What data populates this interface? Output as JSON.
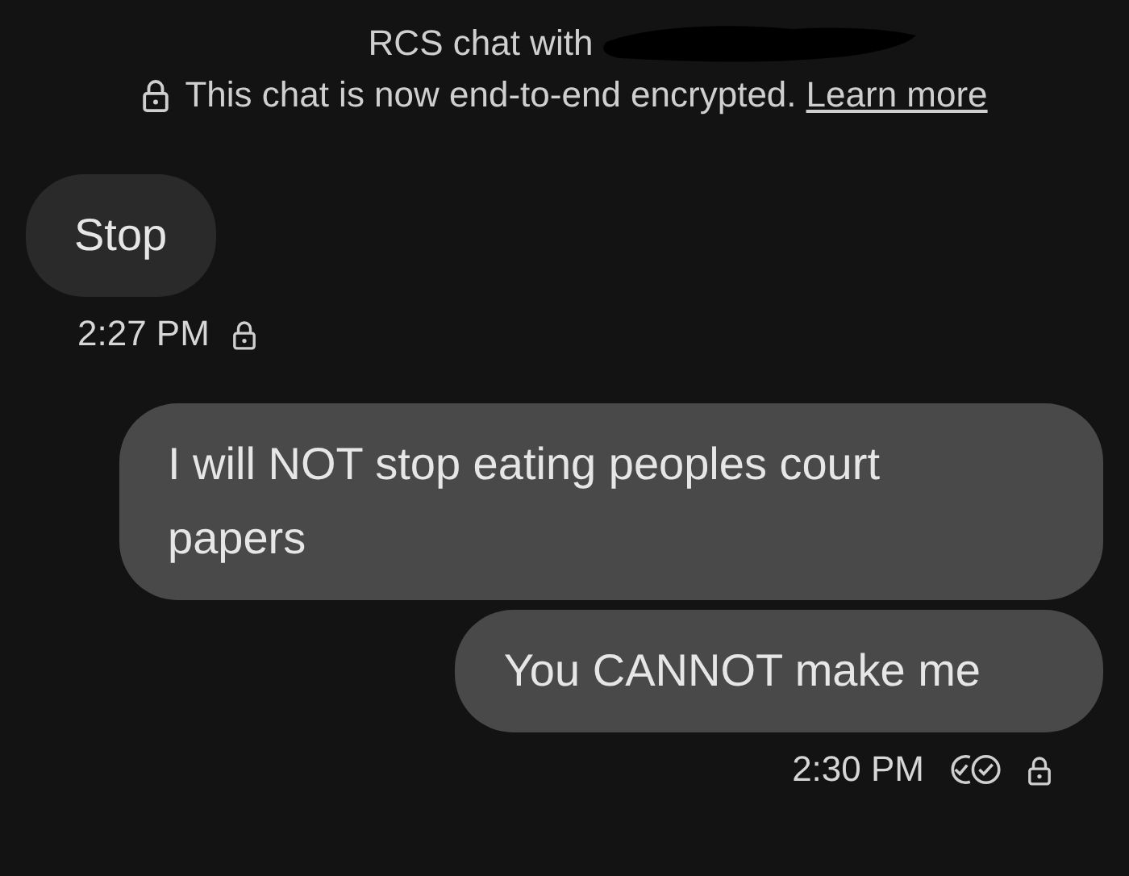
{
  "header": {
    "title": "RCS chat with",
    "name_redacted": true,
    "notice": "This chat is now end-to-end encrypted.",
    "link": "Learn more"
  },
  "groups": [
    {
      "outgoing": false,
      "messages": [
        "Stop"
      ],
      "time": "2:27 PM",
      "encrypted": true
    },
    {
      "outgoing": true,
      "messages": [
        "I will NOT stop eating peoples court papers",
        "You CANNOT make me"
      ],
      "time": "2:30 PM",
      "read": true,
      "encrypted": true
    }
  ]
}
